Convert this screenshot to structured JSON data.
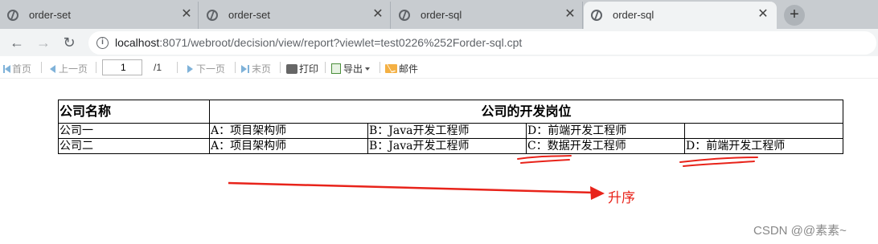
{
  "tabs": [
    {
      "title": "order-set",
      "active": false
    },
    {
      "title": "order-set",
      "active": false
    },
    {
      "title": "order-sql",
      "active": false
    },
    {
      "title": "order-sql",
      "active": true
    }
  ],
  "address": {
    "host": "localhost",
    "rest": ":8071/webroot/decision/view/report?viewlet=test0226%252Forder-sql.cpt"
  },
  "report_toolbar": {
    "first": "首页",
    "prev": "上一页",
    "page_value": "1",
    "page_total": "/1",
    "next": "下一页",
    "last": "末页",
    "print": "打印",
    "export": "导出",
    "mail": "邮件"
  },
  "report": {
    "header": {
      "company": "公司名称",
      "positions": "公司的开发岗位"
    },
    "rows": [
      {
        "company": "公司一",
        "cells": [
          "A：项目架构师",
          "B：Java开发工程师",
          "D：前端开发工程师",
          ""
        ]
      },
      {
        "company": "公司二",
        "cells": [
          "A：项目架构师",
          "B：Java开发工程师",
          "C：数据开发工程师",
          "D：前端开发工程师"
        ]
      }
    ]
  },
  "annotation": {
    "label": "升序",
    "color": "#e8231a"
  },
  "watermark": "CSDN @@素素~"
}
